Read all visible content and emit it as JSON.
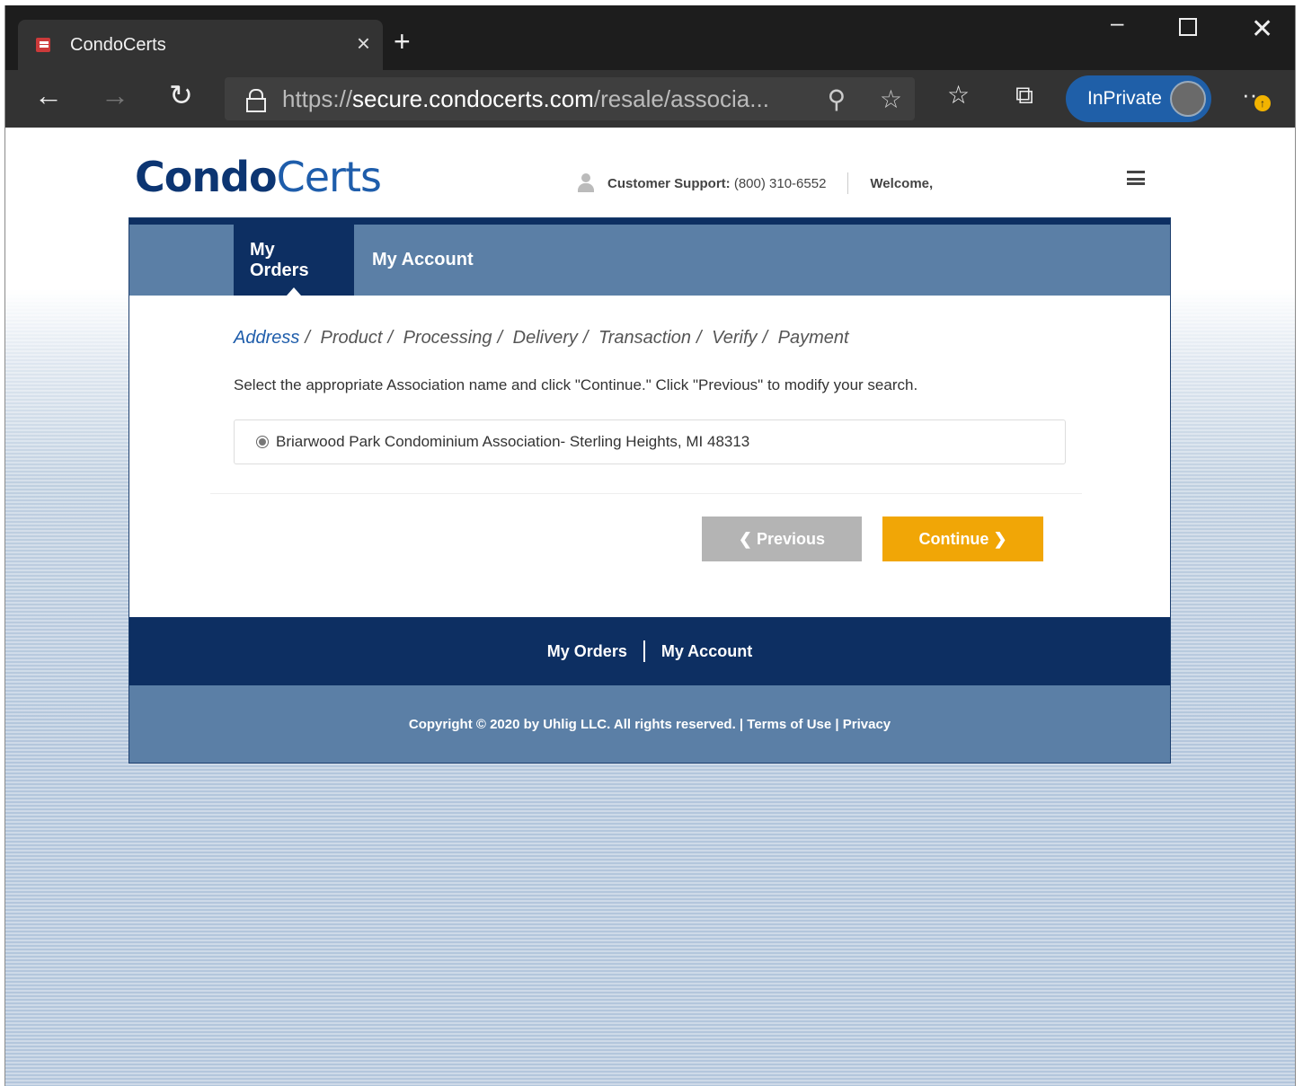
{
  "browser": {
    "tab_title": "CondoCerts",
    "url_scheme": "https://",
    "url_host": "secure.condocerts.com",
    "url_path": "/resale/associa...",
    "inprivate_label": "InPrivate"
  },
  "header": {
    "logo_part1": "Condo",
    "logo_part2": "Certs",
    "support_label": "Customer Support:",
    "support_phone": "(800) 310-6552",
    "welcome": "Welcome,"
  },
  "nav": {
    "items": [
      {
        "label": "My Orders",
        "active": true
      },
      {
        "label": "My Account",
        "active": false
      }
    ]
  },
  "breadcrumb": {
    "steps": [
      "Address",
      "Product",
      "Processing",
      "Delivery",
      "Transaction",
      "Verify",
      "Payment"
    ],
    "active_step": "Address"
  },
  "instructions": "Select the appropriate Association name and click \"Continue.\" Click \"Previous\" to modify your search.",
  "association": {
    "name": "Briarwood Park Condominium Association",
    "location": " - Sterling Heights, MI 48313",
    "selected": true
  },
  "buttons": {
    "previous": "Previous",
    "continue": "Continue"
  },
  "footer": {
    "nav_orders": "My Orders",
    "nav_account": "My Account",
    "copyright": "Copyright © 2020 by Uhlig LLC. All rights reserved. | Terms of Use | Privacy"
  },
  "colors": {
    "brand_dark": "#0d2f62",
    "brand_mid": "#5b7fa6",
    "continue_orange": "#f1a606",
    "previous_gray": "#b4b4b4"
  }
}
